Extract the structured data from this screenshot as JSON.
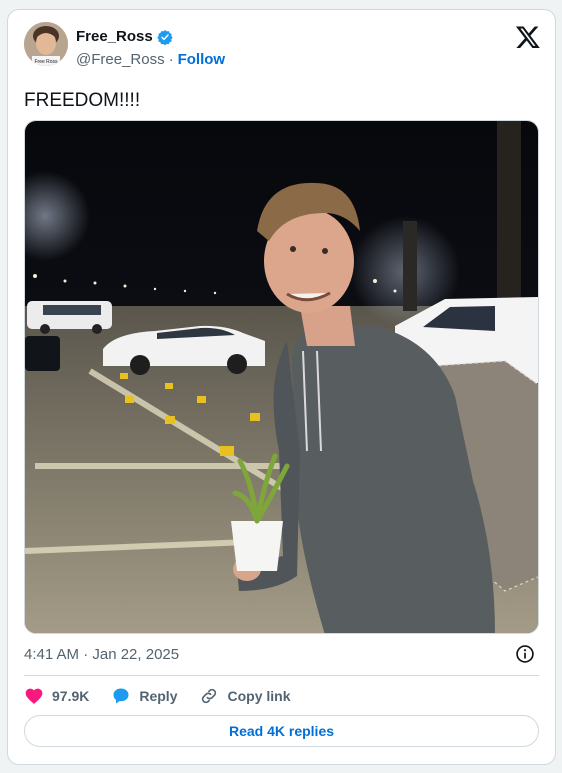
{
  "author": {
    "name": "Free_Ross",
    "handle": "@Free_Ross",
    "separator": "·",
    "follow_label": "Follow",
    "avatar_caption": "Free Ross"
  },
  "tweet": {
    "text": "FREEDOM!!!!",
    "timestamp": "4:41 AM · Jan 22, 2025"
  },
  "actions": {
    "likes": "97.9K",
    "reply_label": "Reply",
    "copy_link_label": "Copy link"
  },
  "read_replies_label": "Read 4K replies",
  "colors": {
    "link": "#006fd6",
    "like": "#f91880",
    "reply": "#1d9bf0",
    "verified": "#1d9bf0",
    "muted": "#536471"
  },
  "icons": [
    "verified-badge-icon",
    "x-logo-icon",
    "info-icon",
    "heart-icon",
    "reply-bubble-icon",
    "link-icon"
  ]
}
